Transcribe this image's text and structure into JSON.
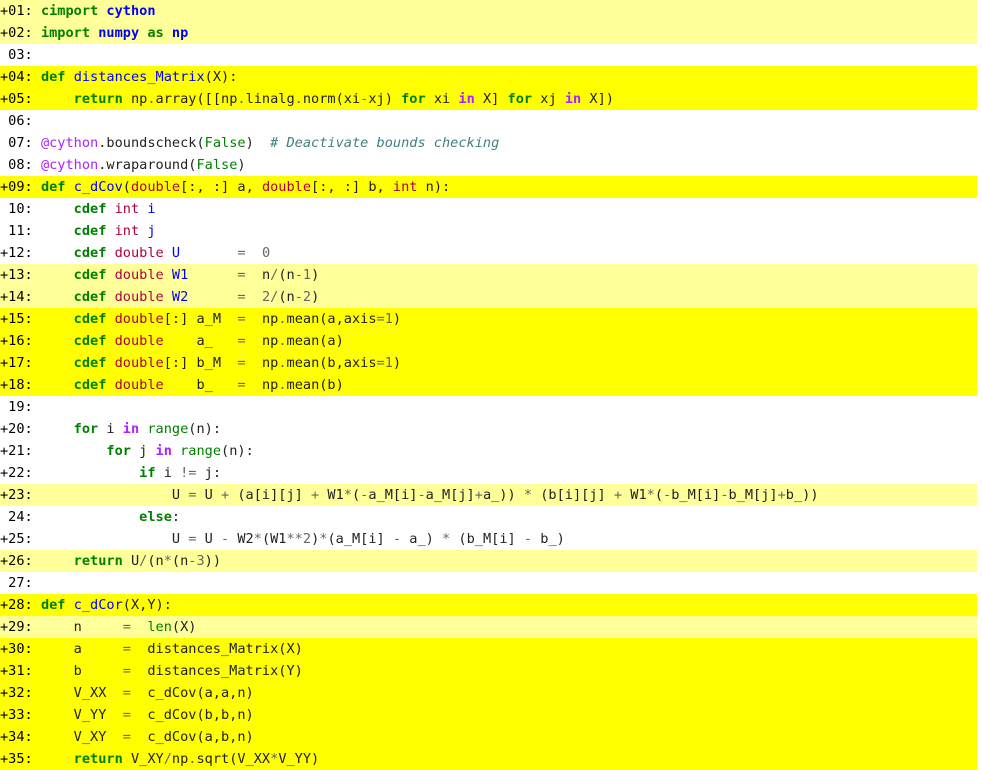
{
  "colors": {
    "bg_plain": "#ffffff",
    "bg_light": "#ffff99",
    "bg_strong": "#ffff00",
    "kw": "#008000",
    "module": "#0000ff",
    "func": "#0000ff",
    "type": "#b00040",
    "number": "#666666",
    "builtin": "#008000",
    "op_word": "#aa22ff",
    "decorator": "#aa22ff",
    "comment": "#408080"
  },
  "lines": [
    {
      "num": "+01:",
      "level": "light",
      "tokens": [
        {
          "t": " "
        },
        {
          "t": "cimport",
          "c": "kw"
        },
        {
          "t": " "
        },
        {
          "t": "cython",
          "c": "mod"
        }
      ]
    },
    {
      "num": "+02:",
      "level": "light",
      "tokens": [
        {
          "t": " "
        },
        {
          "t": "import",
          "c": "kw"
        },
        {
          "t": " "
        },
        {
          "t": "numpy",
          "c": "mod"
        },
        {
          "t": " "
        },
        {
          "t": "as",
          "c": "kw"
        },
        {
          "t": " "
        },
        {
          "t": "np",
          "c": "mod"
        }
      ]
    },
    {
      "num": " 03:",
      "level": "plain",
      "tokens": []
    },
    {
      "num": "+04:",
      "level": "strong",
      "tokens": [
        {
          "t": " "
        },
        {
          "t": "def",
          "c": "kw"
        },
        {
          "t": " "
        },
        {
          "t": "distances_Matrix",
          "c": "fn"
        },
        {
          "t": "(X):"
        }
      ]
    },
    {
      "num": "+05:",
      "level": "strong",
      "tokens": [
        {
          "t": "     "
        },
        {
          "t": "return",
          "c": "kw"
        },
        {
          "t": " np"
        },
        {
          "t": ".",
          "c": "op"
        },
        {
          "t": "array([[np"
        },
        {
          "t": ".",
          "c": "op"
        },
        {
          "t": "linalg"
        },
        {
          "t": ".",
          "c": "op"
        },
        {
          "t": "norm(xi"
        },
        {
          "t": "-",
          "c": "op"
        },
        {
          "t": "xj) "
        },
        {
          "t": "for",
          "c": "kw"
        },
        {
          "t": " xi "
        },
        {
          "t": "in",
          "c": "opw"
        },
        {
          "t": " X] "
        },
        {
          "t": "for",
          "c": "kw"
        },
        {
          "t": " xj "
        },
        {
          "t": "in",
          "c": "opw"
        },
        {
          "t": " X])"
        }
      ]
    },
    {
      "num": " 06:",
      "level": "plain",
      "tokens": []
    },
    {
      "num": " 07:",
      "level": "plain",
      "tokens": [
        {
          "t": " "
        },
        {
          "t": "@cython",
          "c": "deco"
        },
        {
          "t": "."
        },
        {
          "t": "boundscheck"
        },
        {
          "t": "("
        },
        {
          "t": "False",
          "c": "bi"
        },
        {
          "t": ")  "
        },
        {
          "t": "# Deactivate bounds checking",
          "c": "cm"
        }
      ]
    },
    {
      "num": " 08:",
      "level": "plain",
      "tokens": [
        {
          "t": " "
        },
        {
          "t": "@cython",
          "c": "deco"
        },
        {
          "t": "."
        },
        {
          "t": "wraparound"
        },
        {
          "t": "("
        },
        {
          "t": "False",
          "c": "bi"
        },
        {
          "t": ")"
        }
      ]
    },
    {
      "num": "+09:",
      "level": "strong",
      "tokens": [
        {
          "t": " "
        },
        {
          "t": "def",
          "c": "kw"
        },
        {
          "t": " "
        },
        {
          "t": "c_dCov",
          "c": "fn"
        },
        {
          "t": "("
        },
        {
          "t": "double",
          "c": "ty"
        },
        {
          "t": "[:, :] a, "
        },
        {
          "t": "double",
          "c": "ty"
        },
        {
          "t": "[:, :] b, "
        },
        {
          "t": "int",
          "c": "ty"
        },
        {
          "t": " n):"
        }
      ]
    },
    {
      "num": " 10:",
      "level": "plain",
      "tokens": [
        {
          "t": "     "
        },
        {
          "t": "cdef",
          "c": "kw"
        },
        {
          "t": " "
        },
        {
          "t": "int",
          "c": "ty"
        },
        {
          "t": " "
        },
        {
          "t": "i",
          "c": "fn"
        }
      ]
    },
    {
      "num": " 11:",
      "level": "plain",
      "tokens": [
        {
          "t": "     "
        },
        {
          "t": "cdef",
          "c": "kw"
        },
        {
          "t": " "
        },
        {
          "t": "int",
          "c": "ty"
        },
        {
          "t": " "
        },
        {
          "t": "j",
          "c": "fn"
        }
      ]
    },
    {
      "num": "+12:",
      "level": "plain",
      "tokens": [
        {
          "t": "     "
        },
        {
          "t": "cdef",
          "c": "kw"
        },
        {
          "t": " "
        },
        {
          "t": "double",
          "c": "ty"
        },
        {
          "t": " "
        },
        {
          "t": "U",
          "c": "fn"
        },
        {
          "t": "       "
        },
        {
          "t": "=",
          "c": "op"
        },
        {
          "t": "  "
        },
        {
          "t": "0",
          "c": "num"
        }
      ]
    },
    {
      "num": "+13:",
      "level": "light",
      "tokens": [
        {
          "t": "     "
        },
        {
          "t": "cdef",
          "c": "kw"
        },
        {
          "t": " "
        },
        {
          "t": "double",
          "c": "ty"
        },
        {
          "t": " "
        },
        {
          "t": "W1",
          "c": "fn"
        },
        {
          "t": "      "
        },
        {
          "t": "=",
          "c": "op"
        },
        {
          "t": "  n"
        },
        {
          "t": "/",
          "c": "op"
        },
        {
          "t": "(n"
        },
        {
          "t": "-",
          "c": "op"
        },
        {
          "t": "1",
          "c": "num"
        },
        {
          "t": ")"
        }
      ]
    },
    {
      "num": "+14:",
      "level": "light",
      "tokens": [
        {
          "t": "     "
        },
        {
          "t": "cdef",
          "c": "kw"
        },
        {
          "t": " "
        },
        {
          "t": "double",
          "c": "ty"
        },
        {
          "t": " "
        },
        {
          "t": "W2",
          "c": "fn"
        },
        {
          "t": "      "
        },
        {
          "t": "=",
          "c": "op"
        },
        {
          "t": "  "
        },
        {
          "t": "2",
          "c": "num"
        },
        {
          "t": "/",
          "c": "op"
        },
        {
          "t": "(n"
        },
        {
          "t": "-",
          "c": "op"
        },
        {
          "t": "2",
          "c": "num"
        },
        {
          "t": ")"
        }
      ]
    },
    {
      "num": "+15:",
      "level": "strong",
      "tokens": [
        {
          "t": "     "
        },
        {
          "t": "cdef",
          "c": "kw"
        },
        {
          "t": " "
        },
        {
          "t": "double",
          "c": "ty"
        },
        {
          "t": "[:] a_M  "
        },
        {
          "t": "=",
          "c": "op"
        },
        {
          "t": "  np"
        },
        {
          "t": ".",
          "c": "op"
        },
        {
          "t": "mean(a,axis"
        },
        {
          "t": "=",
          "c": "op"
        },
        {
          "t": "1",
          "c": "num"
        },
        {
          "t": ")"
        }
      ]
    },
    {
      "num": "+16:",
      "level": "strong",
      "tokens": [
        {
          "t": "     "
        },
        {
          "t": "cdef",
          "c": "kw"
        },
        {
          "t": " "
        },
        {
          "t": "double",
          "c": "ty"
        },
        {
          "t": "    a_   "
        },
        {
          "t": "=",
          "c": "op"
        },
        {
          "t": "  np"
        },
        {
          "t": ".",
          "c": "op"
        },
        {
          "t": "mean(a)"
        }
      ]
    },
    {
      "num": "+17:",
      "level": "strong",
      "tokens": [
        {
          "t": "     "
        },
        {
          "t": "cdef",
          "c": "kw"
        },
        {
          "t": " "
        },
        {
          "t": "double",
          "c": "ty"
        },
        {
          "t": "[:] b_M  "
        },
        {
          "t": "=",
          "c": "op"
        },
        {
          "t": "  np"
        },
        {
          "t": ".",
          "c": "op"
        },
        {
          "t": "mean(b,axis"
        },
        {
          "t": "=",
          "c": "op"
        },
        {
          "t": "1",
          "c": "num"
        },
        {
          "t": ")"
        }
      ]
    },
    {
      "num": "+18:",
      "level": "strong",
      "tokens": [
        {
          "t": "     "
        },
        {
          "t": "cdef",
          "c": "kw"
        },
        {
          "t": " "
        },
        {
          "t": "double",
          "c": "ty"
        },
        {
          "t": "    b_   "
        },
        {
          "t": "=",
          "c": "op"
        },
        {
          "t": "  np"
        },
        {
          "t": ".",
          "c": "op"
        },
        {
          "t": "mean(b)"
        }
      ]
    },
    {
      "num": " 19:",
      "level": "plain",
      "tokens": []
    },
    {
      "num": "+20:",
      "level": "plain",
      "tokens": [
        {
          "t": "     "
        },
        {
          "t": "for",
          "c": "kw"
        },
        {
          "t": " i "
        },
        {
          "t": "in",
          "c": "opw"
        },
        {
          "t": " "
        },
        {
          "t": "range",
          "c": "bi"
        },
        {
          "t": "(n):"
        }
      ]
    },
    {
      "num": "+21:",
      "level": "plain",
      "tokens": [
        {
          "t": "         "
        },
        {
          "t": "for",
          "c": "kw"
        },
        {
          "t": " j "
        },
        {
          "t": "in",
          "c": "opw"
        },
        {
          "t": " "
        },
        {
          "t": "range",
          "c": "bi"
        },
        {
          "t": "(n):"
        }
      ]
    },
    {
      "num": "+22:",
      "level": "plain",
      "tokens": [
        {
          "t": "             "
        },
        {
          "t": "if",
          "c": "kw"
        },
        {
          "t": " i "
        },
        {
          "t": "!=",
          "c": "op"
        },
        {
          "t": " j:"
        }
      ]
    },
    {
      "num": "+23:",
      "level": "light",
      "tokens": [
        {
          "t": "                 U "
        },
        {
          "t": "=",
          "c": "op"
        },
        {
          "t": " U "
        },
        {
          "t": "+",
          "c": "op"
        },
        {
          "t": " (a[i][j] "
        },
        {
          "t": "+",
          "c": "op"
        },
        {
          "t": " W1"
        },
        {
          "t": "*",
          "c": "op"
        },
        {
          "t": "("
        },
        {
          "t": "-",
          "c": "op"
        },
        {
          "t": "a_M[i]"
        },
        {
          "t": "-",
          "c": "op"
        },
        {
          "t": "a_M[j]"
        },
        {
          "t": "+",
          "c": "op"
        },
        {
          "t": "a_)) "
        },
        {
          "t": "*",
          "c": "op"
        },
        {
          "t": " (b[i][j] "
        },
        {
          "t": "+",
          "c": "op"
        },
        {
          "t": " W1"
        },
        {
          "t": "*",
          "c": "op"
        },
        {
          "t": "("
        },
        {
          "t": "-",
          "c": "op"
        },
        {
          "t": "b_M[i]"
        },
        {
          "t": "-",
          "c": "op"
        },
        {
          "t": "b_M[j]"
        },
        {
          "t": "+",
          "c": "op"
        },
        {
          "t": "b_))"
        }
      ]
    },
    {
      "num": " 24:",
      "level": "plain",
      "tokens": [
        {
          "t": "             "
        },
        {
          "t": "else",
          "c": "kw"
        },
        {
          "t": ":"
        }
      ]
    },
    {
      "num": "+25:",
      "level": "plain",
      "tokens": [
        {
          "t": "                 U "
        },
        {
          "t": "=",
          "c": "op"
        },
        {
          "t": " U "
        },
        {
          "t": "-",
          "c": "op"
        },
        {
          "t": " W2"
        },
        {
          "t": "*",
          "c": "op"
        },
        {
          "t": "(W1"
        },
        {
          "t": "**",
          "c": "op"
        },
        {
          "t": "2",
          "c": "num"
        },
        {
          "t": ")"
        },
        {
          "t": "*",
          "c": "op"
        },
        {
          "t": "(a_M[i] "
        },
        {
          "t": "-",
          "c": "op"
        },
        {
          "t": " a_) "
        },
        {
          "t": "*",
          "c": "op"
        },
        {
          "t": " (b_M[i] "
        },
        {
          "t": "-",
          "c": "op"
        },
        {
          "t": " b_)"
        }
      ]
    },
    {
      "num": "+26:",
      "level": "light",
      "tokens": [
        {
          "t": "     "
        },
        {
          "t": "return",
          "c": "kw"
        },
        {
          "t": " U"
        },
        {
          "t": "/",
          "c": "op"
        },
        {
          "t": "(n"
        },
        {
          "t": "*",
          "c": "op"
        },
        {
          "t": "(n"
        },
        {
          "t": "-",
          "c": "op"
        },
        {
          "t": "3",
          "c": "num"
        },
        {
          "t": "))"
        }
      ]
    },
    {
      "num": " 27:",
      "level": "plain",
      "tokens": []
    },
    {
      "num": "+28:",
      "level": "strong",
      "tokens": [
        {
          "t": " "
        },
        {
          "t": "def",
          "c": "kw"
        },
        {
          "t": " "
        },
        {
          "t": "c_dCor",
          "c": "fn"
        },
        {
          "t": "(X,Y):"
        }
      ]
    },
    {
      "num": "+29:",
      "level": "light",
      "tokens": [
        {
          "t": "     n     "
        },
        {
          "t": "=",
          "c": "op"
        },
        {
          "t": "  "
        },
        {
          "t": "len",
          "c": "bi"
        },
        {
          "t": "(X)"
        }
      ]
    },
    {
      "num": "+30:",
      "level": "strong",
      "tokens": [
        {
          "t": "     a     "
        },
        {
          "t": "=",
          "c": "op"
        },
        {
          "t": "  distances_Matrix(X)"
        }
      ]
    },
    {
      "num": "+31:",
      "level": "strong",
      "tokens": [
        {
          "t": "     b     "
        },
        {
          "t": "=",
          "c": "op"
        },
        {
          "t": "  distances_Matrix(Y)"
        }
      ]
    },
    {
      "num": "+32:",
      "level": "strong",
      "tokens": [
        {
          "t": "     V_XX  "
        },
        {
          "t": "=",
          "c": "op"
        },
        {
          "t": "  c_dCov(a,a,n)"
        }
      ]
    },
    {
      "num": "+33:",
      "level": "strong",
      "tokens": [
        {
          "t": "     V_YY  "
        },
        {
          "t": "=",
          "c": "op"
        },
        {
          "t": "  c_dCov(b,b,n)"
        }
      ]
    },
    {
      "num": "+34:",
      "level": "strong",
      "tokens": [
        {
          "t": "     V_XY  "
        },
        {
          "t": "=",
          "c": "op"
        },
        {
          "t": "  c_dCov(a,b,n)"
        }
      ]
    },
    {
      "num": "+35:",
      "level": "strong",
      "tokens": [
        {
          "t": "     "
        },
        {
          "t": "return",
          "c": "kw"
        },
        {
          "t": " V_XY"
        },
        {
          "t": "/",
          "c": "op"
        },
        {
          "t": "np"
        },
        {
          "t": ".",
          "c": "op"
        },
        {
          "t": "sqrt(V_XX"
        },
        {
          "t": "*",
          "c": "op"
        },
        {
          "t": "V_YY)"
        }
      ]
    }
  ]
}
